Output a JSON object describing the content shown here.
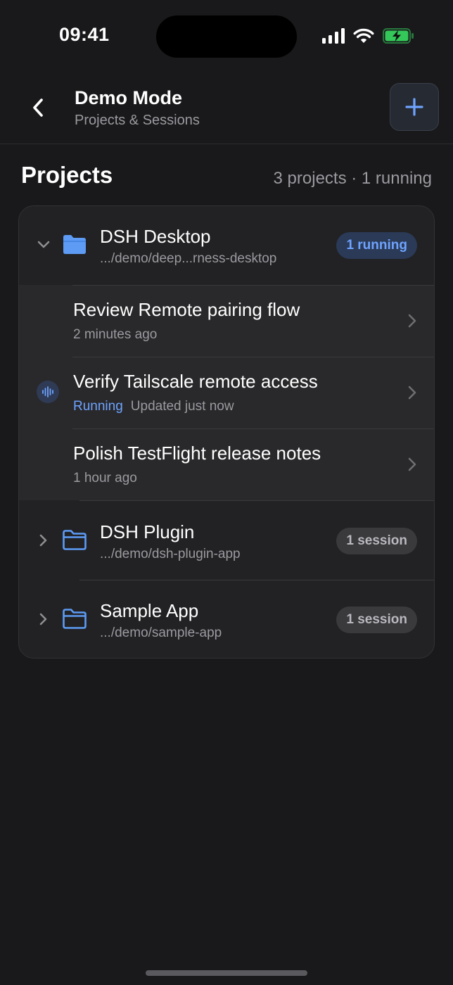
{
  "status_bar": {
    "time": "09:41"
  },
  "nav": {
    "title": "Demo Mode",
    "subtitle": "Projects & Sessions"
  },
  "section": {
    "title": "Projects",
    "meta": "3 projects · 1 running"
  },
  "projects": [
    {
      "name": "DSH Desktop",
      "path": ".../demo/deep...rness-desktop",
      "badge": "1 running",
      "expanded": true,
      "sessions": [
        {
          "title": "Review Remote pairing flow",
          "status": "",
          "updated": "2 minutes ago"
        },
        {
          "title": "Verify Tailscale remote access",
          "status": "Running",
          "updated": "Updated just now"
        },
        {
          "title": "Polish TestFlight release notes",
          "status": "",
          "updated": "1 hour ago"
        }
      ]
    },
    {
      "name": "DSH Plugin",
      "path": ".../demo/dsh-plugin-app",
      "badge": "1 session",
      "expanded": false
    },
    {
      "name": "Sample App",
      "path": ".../demo/sample-app",
      "badge": "1 session",
      "expanded": false
    }
  ],
  "colors": {
    "background": "#19191b",
    "card": "#222224",
    "accent_blue": "#6ea3ff",
    "battery_green": "#34c759",
    "secondary_text": "#9a9aa0"
  },
  "icons": {
    "back": "chevron-left-icon",
    "add": "plus-icon",
    "folder_filled": "folder-fill-icon",
    "folder_outline": "folder-icon",
    "running": "waveform-icon",
    "disclosure": "chevron-right-icon"
  }
}
